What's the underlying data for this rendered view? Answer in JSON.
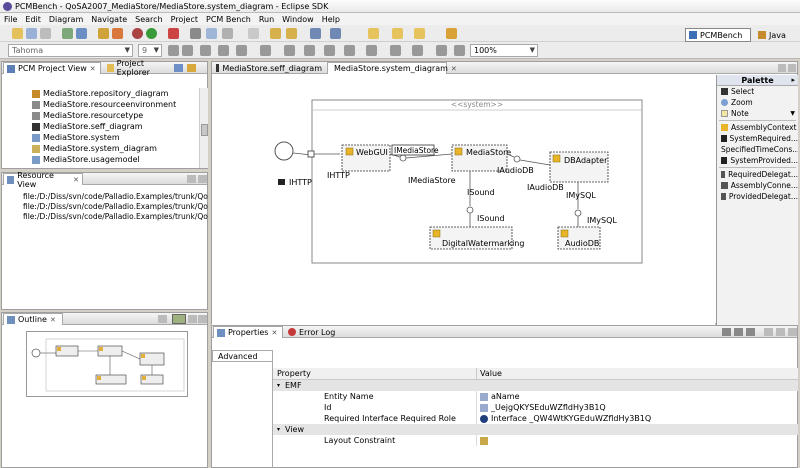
{
  "window": {
    "title": "PCMBench - QoSA2007_MediaStore/MediaStore.system_diagram - Eclipse SDK"
  },
  "menu": [
    "File",
    "Edit",
    "Diagram",
    "Navigate",
    "Search",
    "Project",
    "PCM Bench",
    "Run",
    "Window",
    "Help"
  ],
  "toolbar": {
    "font_combo": "Tahoma",
    "size_combo": "9",
    "zoom_combo": "100%"
  },
  "perspectives": {
    "active": "PCMBench",
    "other": "Java"
  },
  "project_view": {
    "tabs": [
      "PCM Project View",
      "Project Explorer"
    ],
    "items": [
      "MediaStore.repository_diagram",
      "MediaStore.resourceenvironment",
      "MediaStore.resourcetype",
      "MediaStore.seff_diagram",
      "MediaStore.system",
      "MediaStore.system_diagram",
      "MediaStore.usagemodel"
    ]
  },
  "resource_view": {
    "tab": "Resource View",
    "items": [
      "file:/D:/Diss/svn/code/Palladio.Examples/trunk/QoSA",
      "file:/D:/Diss/svn/code/Palladio.Examples/trunk/QoSA",
      "file:/D:/Diss/svn/code/Palladio.Examples/trunk/QoSA"
    ]
  },
  "outline": {
    "tab": "Outline"
  },
  "editor": {
    "tabs": [
      "MediaStore.seff_diagram",
      "MediaStore.system_diagram"
    ],
    "diagram": {
      "system_label": "<<system>>",
      "components": {
        "webgui": "WebGUI",
        "mediastore": "MediaStore",
        "dbadapter": "DBAdapter",
        "digitalwatermarking": "DigitalWatermarking",
        "audiodb": "AudioDB"
      },
      "labels": {
        "ihttp_outer": "IHTTP",
        "ihttp_inner": "IHTTP",
        "imediastore_top": "IMediaStore",
        "imediastore_bottom": "IMediaStore",
        "iaudiodb_top": "IAudioDB",
        "iaudiodb_bottom": "IAudioDB",
        "isound_top": "ISound",
        "isound_bottom": "ISound",
        "imysql_top": "IMySQL",
        "imysql_bottom": "IMySQL"
      }
    }
  },
  "palette": {
    "title": "Palette",
    "tools": [
      "Select",
      "Zoom",
      "Note"
    ],
    "group1": [
      "AssemblyContext",
      "SystemRequired...",
      "SpecifiedTimeCons...",
      "SystemProvided..."
    ],
    "group2": [
      "RequiredDelegat...",
      "AssemblyConne...",
      "ProvidedDelegat..."
    ]
  },
  "properties": {
    "tabs": [
      "Properties",
      "Error Log"
    ],
    "side_tab": "Advanced",
    "columns": [
      "Property",
      "Value"
    ],
    "rows": [
      {
        "indent": 1,
        "property": "EMF",
        "value": ""
      },
      {
        "indent": 2,
        "property": "Entity Name",
        "value": "aName"
      },
      {
        "indent": 2,
        "property": "Id",
        "value": "_UejgQKYSEduWZfldHy3B1Q"
      },
      {
        "indent": 2,
        "property": "Required Interface Required Role",
        "value": "Interface _QW4WtKYGEduWZfldHy3B1Q"
      },
      {
        "indent": 1,
        "property": "View",
        "value": ""
      },
      {
        "indent": 2,
        "property": "Layout Constraint",
        "value": ""
      }
    ]
  },
  "colors": {
    "accent": "#0a246a",
    "component_fill": "#f4f4f4",
    "component_icon": "#e8b52a"
  }
}
